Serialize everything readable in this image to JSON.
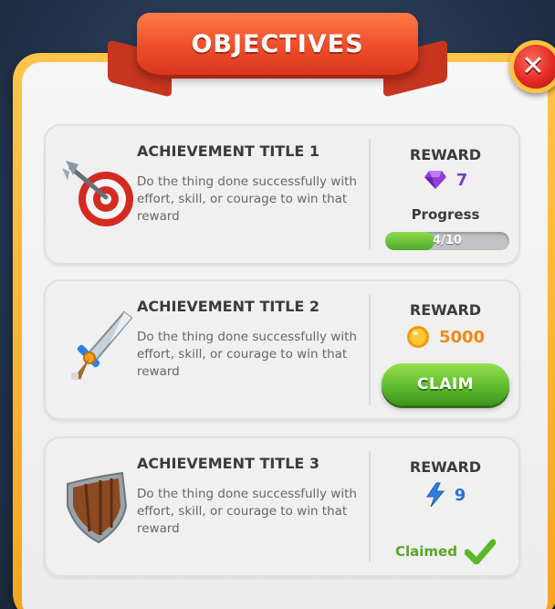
{
  "window": {
    "title": "OBJECTIVES",
    "close_icon": "close-icon"
  },
  "colors": {
    "frame": "#f4a51f",
    "banner": "#ef4d2a",
    "gem": "#8e3fd6",
    "coin": "#f29a0c",
    "lightning": "#2f7ee0",
    "green": "#5bb82a"
  },
  "achievements": [
    {
      "title": "ACHIEVEMENT TITLE 1",
      "description": "Do the thing done successfully with effort, skill, or courage to win that reward",
      "icon": "target-arrow-icon",
      "reward_label": "REWARD",
      "reward_icon": "gem-icon",
      "reward_value": "7",
      "state": "in_progress",
      "progress_label": "Progress",
      "progress_text": "4/10",
      "progress_fraction": 0.4
    },
    {
      "title": "ACHIEVEMENT TITLE 2",
      "description": "Do the thing done successfully with effort, skill, or courage to win that reward",
      "icon": "sword-icon",
      "reward_label": "REWARD",
      "reward_icon": "coin-icon",
      "reward_value": "5000",
      "state": "claimable",
      "claim_label": "CLAIM"
    },
    {
      "title": "ACHIEVEMENT TITLE 3",
      "description": "Do the thing done successfully with effort, skill, or courage to win that reward",
      "icon": "shield-icon",
      "reward_label": "REWARD",
      "reward_icon": "lightning-icon",
      "reward_value": "9",
      "state": "claimed",
      "claimed_label": "Claimed",
      "claimed_icon": "checkmark-icon"
    }
  ]
}
